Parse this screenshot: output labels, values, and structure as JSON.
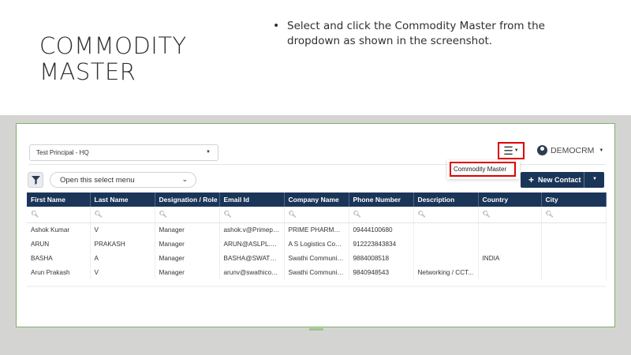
{
  "slide": {
    "title_line1": "COMMODITY",
    "title_line2": "MASTER",
    "bullet": "Select and click the Commodity Master from the dropdown as shown in the screenshot."
  },
  "app": {
    "principal_select": "Test Principal - HQ",
    "menu_icon": "hamburger-menu-icon",
    "user_name": "DEMOCRM",
    "view_select": "Open this select menu",
    "dropdown_item": "Commodity Master",
    "new_contact_label": "New Contact",
    "accent_color": "#1a3558",
    "highlight_color": "#e00000"
  },
  "table": {
    "columns": [
      "First Name",
      "Last Name",
      "Designation / Role",
      "Email Id",
      "Company Name",
      "Phone Number",
      "Description",
      "Country",
      "City"
    ],
    "rows": [
      [
        "Ashok Kumar",
        "V",
        "Manager",
        "ashok.v@Primeph...",
        "PRIME PHARMAC...",
        "09444100680",
        "",
        "",
        ""
      ],
      [
        "ARUN",
        "PRAKASH",
        "Manager",
        "ARUN@ASLPL.COM",
        "A S Logistics Com...",
        "912223843834",
        "",
        "",
        ""
      ],
      [
        "BASHA",
        "A",
        "Manager",
        "BASHA@SWATHIC...",
        "Swathi Communic...",
        "9884008518",
        "",
        "INDIA",
        ""
      ],
      [
        "Arun Prakash",
        "V",
        "Manager",
        "arunv@swathicom...",
        "Swathi Communic...",
        "9840948543",
        "Networking / CCT...",
        "",
        ""
      ]
    ]
  }
}
